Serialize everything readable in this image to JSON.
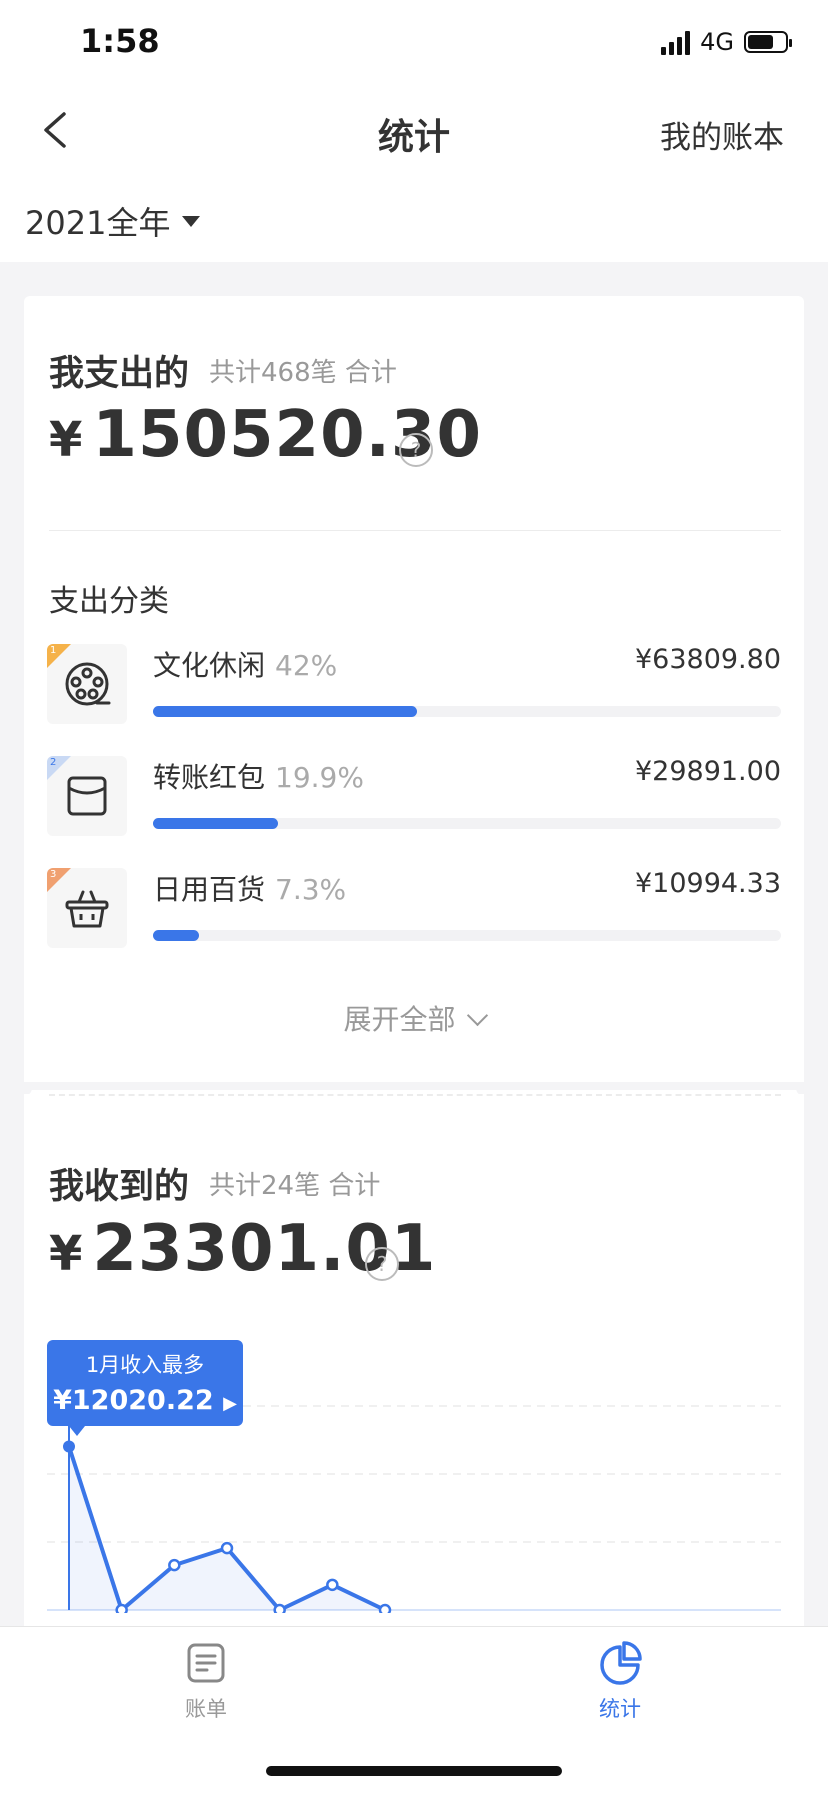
{
  "status_bar": {
    "time": "1:58",
    "network": "4G"
  },
  "nav": {
    "title": "统计",
    "right_link": "我的账本"
  },
  "period": {
    "label": "2021全年"
  },
  "expense": {
    "title": "我支出的",
    "subtitle": "共计468笔 合计",
    "currency": "¥",
    "amount": "150520.30",
    "categories_title": "支出分类",
    "categories": [
      {
        "rank": "1",
        "name": "文化休闲",
        "percent": "42%",
        "amount": "¥63809.80",
        "share": 0.42,
        "icon": "film-reel-icon"
      },
      {
        "rank": "2",
        "name": "转账红包",
        "percent": "19.9%",
        "amount": "¥29891.00",
        "share": 0.199,
        "icon": "envelope-icon"
      },
      {
        "rank": "3",
        "name": "日用百货",
        "percent": "7.3%",
        "amount": "¥10994.33",
        "share": 0.073,
        "icon": "basket-icon"
      }
    ],
    "expand_label": "展开全部"
  },
  "income": {
    "title": "我收到的",
    "subtitle": "共计24笔 合计",
    "currency": "¥",
    "amount": "23301.01",
    "tooltip": {
      "title": "1月收入最多",
      "value": "¥12020.22"
    }
  },
  "chart_data": {
    "type": "line",
    "x": [
      1,
      2,
      3,
      4,
      5,
      6,
      7
    ],
    "values": [
      12020.22,
      0,
      3300,
      4550,
      0,
      1850,
      0
    ],
    "ylim": [
      0,
      20000
    ],
    "xlim": [
      1,
      13
    ],
    "grid": true,
    "highlight_index": 0,
    "color": "#3a76e8"
  },
  "tab_bar": {
    "tabs": [
      {
        "label": "账单",
        "active": false,
        "icon": "bill-icon"
      },
      {
        "label": "统计",
        "active": true,
        "icon": "pie-chart-icon"
      }
    ]
  },
  "colors": {
    "accent": "#3a76e8",
    "rank1": "#f5b24a",
    "rank2": "#c9d9f4",
    "rank3": "#f0a070"
  }
}
